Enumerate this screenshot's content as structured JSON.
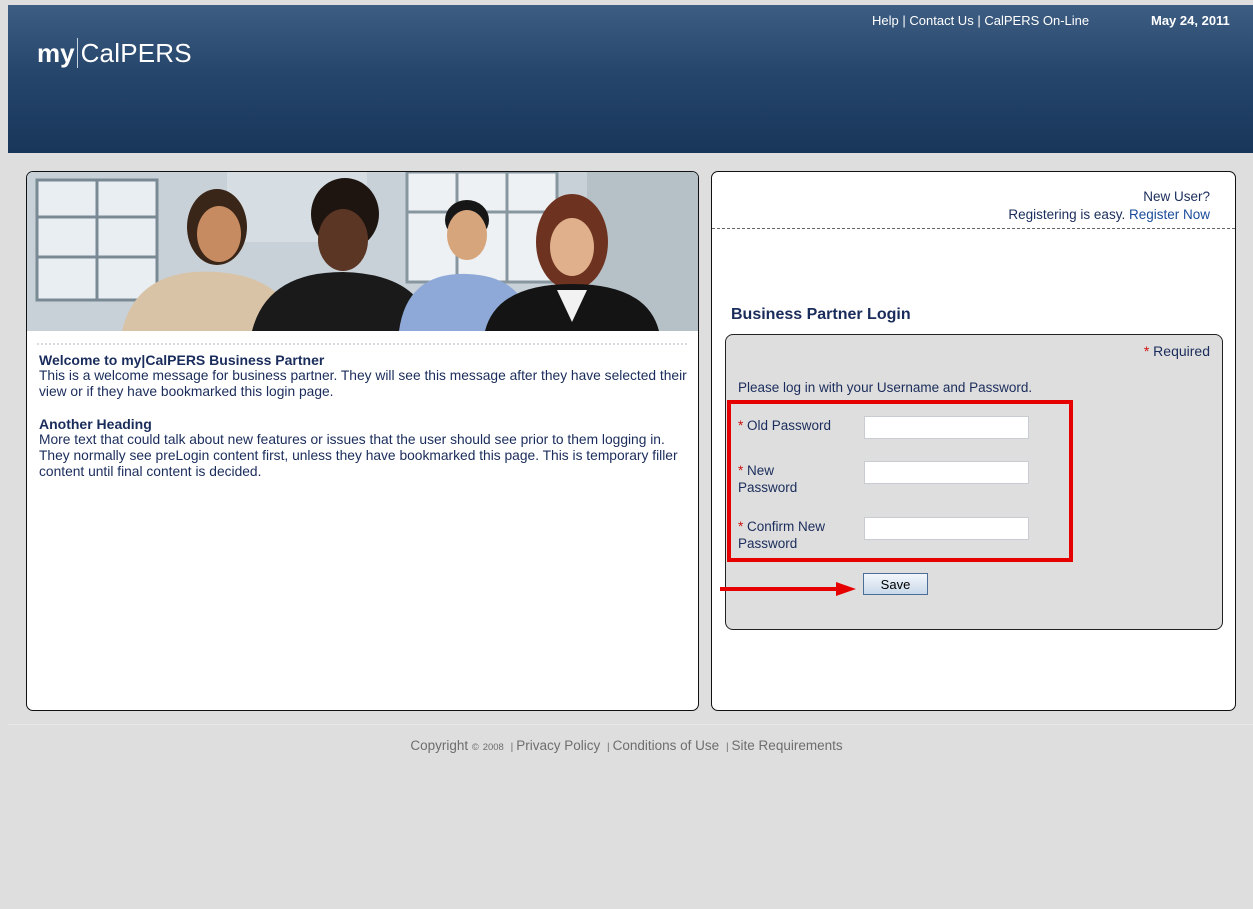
{
  "header": {
    "logo_my": "my",
    "logo_name": "CalPERS",
    "links": [
      "Help",
      "Contact Us",
      "CalPERS On-Line"
    ],
    "date": "May 24, 2011"
  },
  "welcome": {
    "heading": "Welcome to my|CalPERS Business Partner",
    "body": "This is a welcome message for business partner. They will see this message after they have selected their view or if they have bookmarked this login page.",
    "heading2": "Another Heading",
    "body2": "More text that could talk about new features or issues that the user should see prior to them logging in. They normally see preLogin content first, unless they have bookmarked this page. This is temporary filler content until final content is decided."
  },
  "new_user": {
    "question": "New User?",
    "prefix": "Registering is easy.",
    "link": "Register Now"
  },
  "login": {
    "title": "Business Partner Login",
    "required_star": "*",
    "required_label": "Required",
    "instructions": "Please log in with your Username and Password.",
    "fields": [
      {
        "label": "Old Password",
        "value": ""
      },
      {
        "label": "New Password",
        "value": ""
      },
      {
        "label": "Confirm New Password",
        "value": ""
      }
    ],
    "save_label": "Save"
  },
  "footer": {
    "copyright": "Copyright",
    "copyright_symbol": "©",
    "year": "2008",
    "links": [
      "Privacy Policy",
      "Conditions of Use",
      "Site Requirements"
    ],
    "separator": "|"
  },
  "colors": {
    "header_blue": "#27466c",
    "text_navy": "#1a2c5b",
    "required_red": "#d01010",
    "highlight_red": "#e60000"
  }
}
